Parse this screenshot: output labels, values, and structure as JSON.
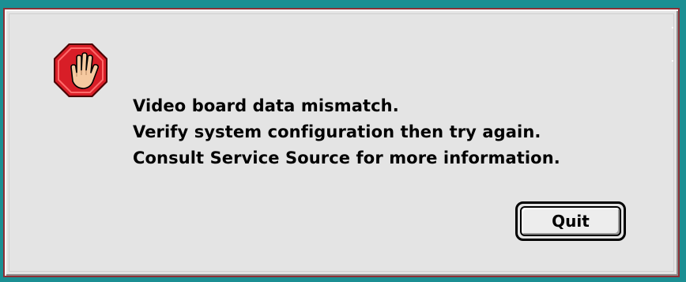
{
  "dialog": {
    "type": "stop-alert",
    "icon": "stop-hand-icon",
    "message_lines": [
      "Video board data mismatch.",
      "Verify system configuration then try again.",
      "Consult Service Source for more information."
    ],
    "quit_label": "Quit"
  },
  "colors": {
    "desktop": "#1b8f93",
    "dialog_bg": "#e4e4e4",
    "dialog_border": "#8c2f35",
    "stop_red": "#d81e27",
    "hand_skin": "#f6c9a0"
  }
}
